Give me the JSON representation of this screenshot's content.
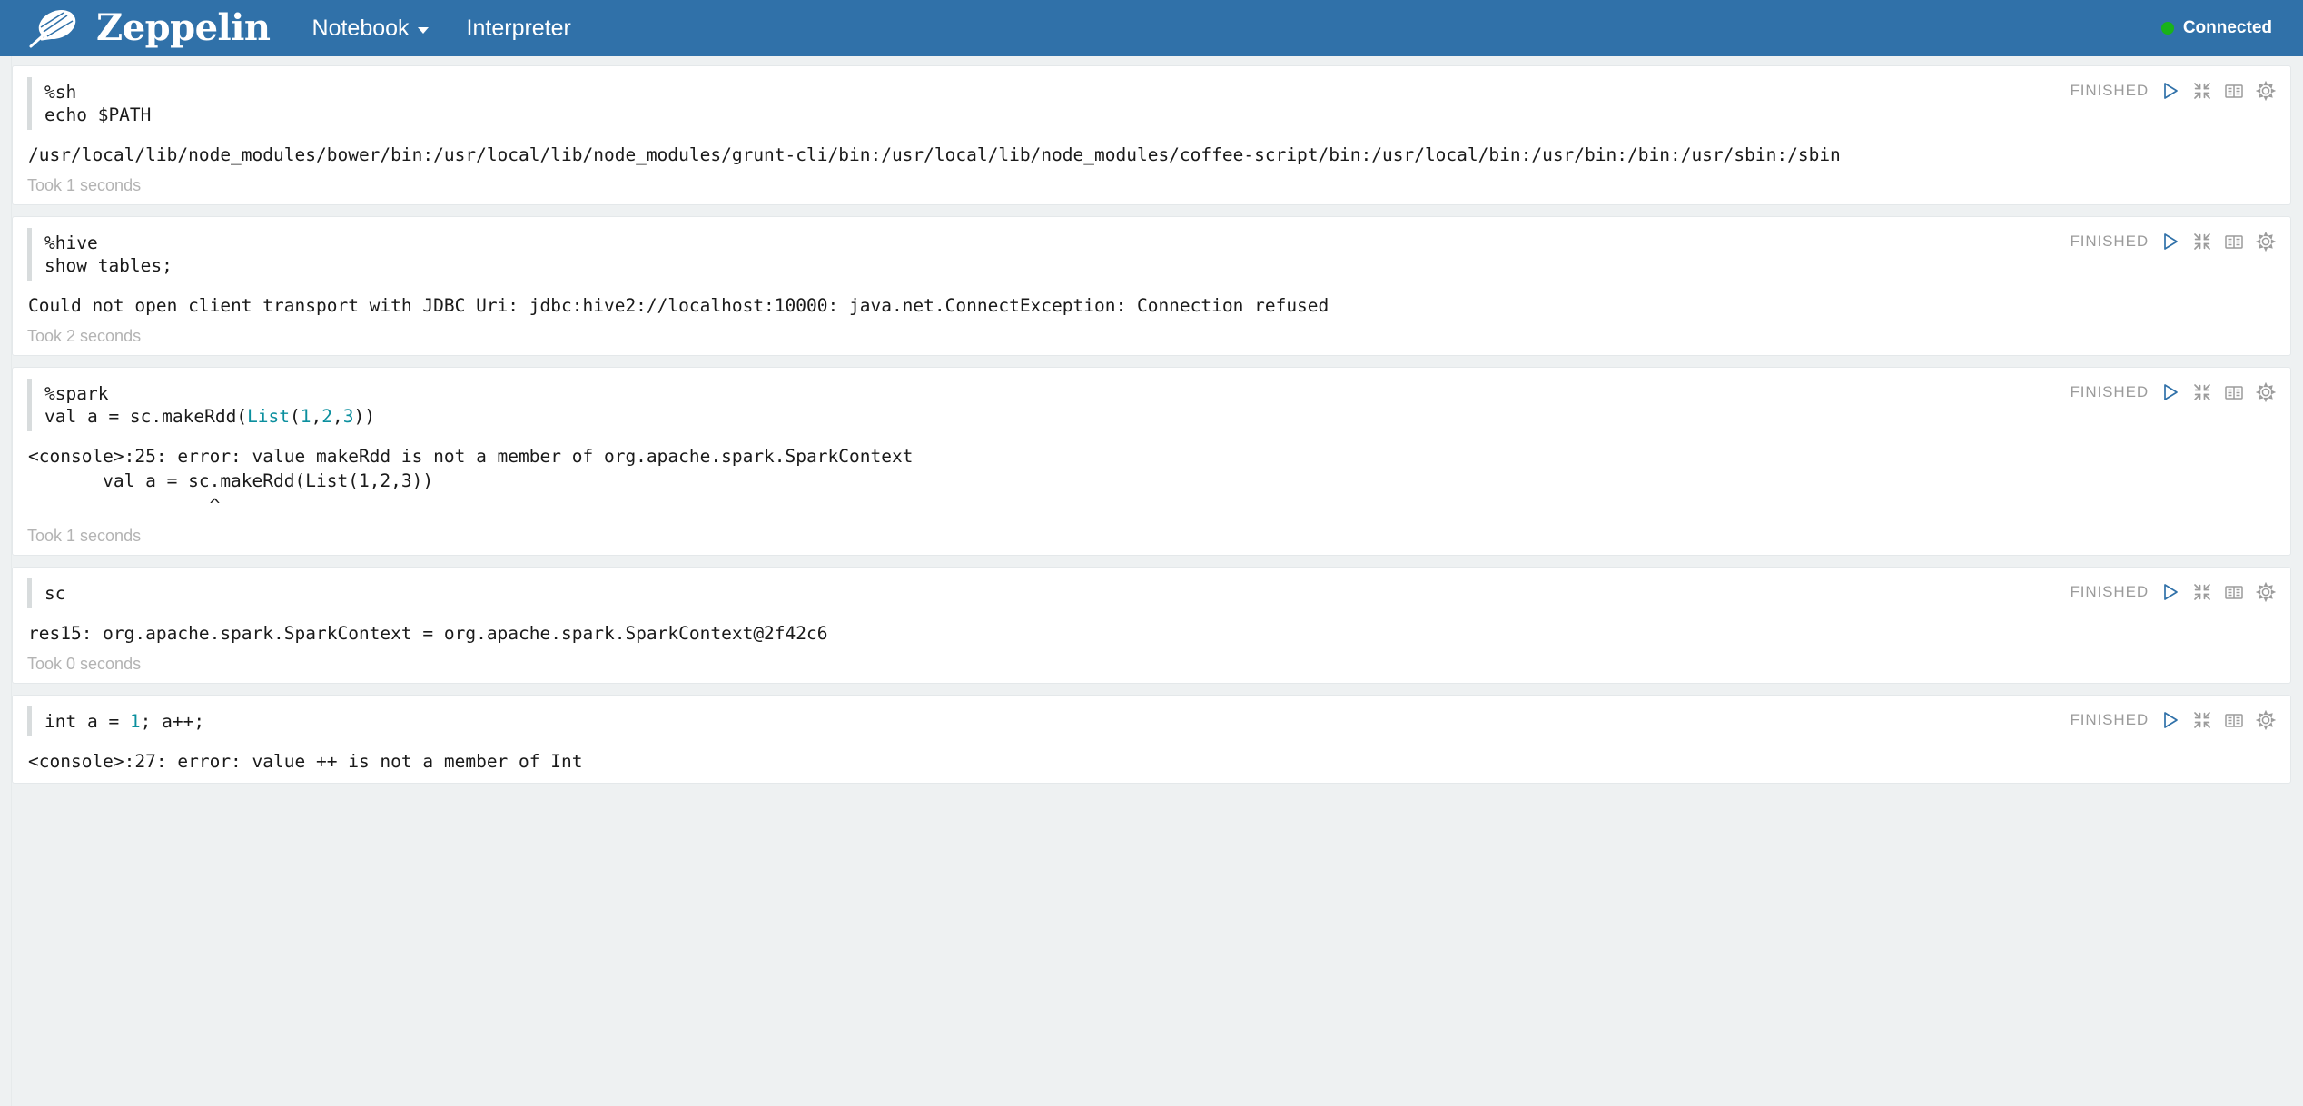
{
  "header": {
    "brand_name": "Zeppelin",
    "logo_icon": "zeppelin-leaf-logo",
    "nav": [
      {
        "label": "Notebook",
        "has_caret": true
      },
      {
        "label": "Interpreter",
        "has_caret": false
      }
    ],
    "connection": {
      "label": "Connected",
      "dot_icon": "status-dot-icon",
      "color": "#19b319"
    }
  },
  "colors": {
    "navbar": "#3071a9",
    "page_background": "#eef1f2",
    "cell_background": "#ffffff",
    "syntax_keyword": "#0b8f9e",
    "run_icon": "#3071a9",
    "status_text": "#9b9b9b"
  },
  "paragraph_controls": {
    "status": "FINISHED",
    "icons": [
      {
        "name": "run-icon",
        "title": "Run"
      },
      {
        "name": "collapse-icon",
        "title": "Collapse"
      },
      {
        "name": "book-icon",
        "title": "Show/Hide editor"
      },
      {
        "name": "gear-icon",
        "title": "Settings"
      }
    ]
  },
  "paragraphs": [
    {
      "id": "paragraph-sh",
      "code": [
        {
          "segments": [
            {
              "text": "%sh",
              "style": "plain"
            }
          ]
        },
        {
          "segments": [
            {
              "text": "echo $PATH",
              "style": "plain"
            }
          ]
        }
      ],
      "status": "FINISHED",
      "result": "/usr/local/lib/node_modules/bower/bin:/usr/local/lib/node_modules/grunt-cli/bin:/usr/local/lib/node_modules/coffee-script/bin:/usr/local/bin:/usr/bin:/bin:/usr/sbin:/sbin",
      "took": "Took 1 seconds"
    },
    {
      "id": "paragraph-hive",
      "code": [
        {
          "segments": [
            {
              "text": "%hive",
              "style": "plain"
            }
          ]
        },
        {
          "segments": [
            {
              "text": "show tables;",
              "style": "plain"
            }
          ]
        }
      ],
      "status": "FINISHED",
      "result": "Could not open client transport with JDBC Uri: jdbc:hive2://localhost:10000: java.net.ConnectException: Connection refused",
      "took": "Took 2 seconds"
    },
    {
      "id": "paragraph-spark",
      "code": [
        {
          "segments": [
            {
              "text": "%spark",
              "style": "plain"
            }
          ]
        },
        {
          "segments": [
            {
              "text": "val a = sc.makeRdd(",
              "style": "plain"
            },
            {
              "text": "List",
              "style": "type"
            },
            {
              "text": "(",
              "style": "plain"
            },
            {
              "text": "1",
              "style": "num"
            },
            {
              "text": ",",
              "style": "plain"
            },
            {
              "text": "2",
              "style": "num"
            },
            {
              "text": ",",
              "style": "plain"
            },
            {
              "text": "3",
              "style": "num"
            },
            {
              "text": "))",
              "style": "plain"
            }
          ]
        }
      ],
      "status": "FINISHED",
      "result": "<console>:25: error: value makeRdd is not a member of org.apache.spark.SparkContext\n       val a = sc.makeRdd(List(1,2,3))\n                 ^",
      "took": "Took 1 seconds"
    },
    {
      "id": "paragraph-sc",
      "code": [
        {
          "segments": [
            {
              "text": "sc",
              "style": "plain"
            }
          ]
        }
      ],
      "status": "FINISHED",
      "result": "res15: org.apache.spark.SparkContext = org.apache.spark.SparkContext@2f42c6",
      "took": "Took 0 seconds"
    },
    {
      "id": "paragraph-int",
      "code": [
        {
          "segments": [
            {
              "text": "int a = ",
              "style": "plain"
            },
            {
              "text": "1",
              "style": "num"
            },
            {
              "text": "; a++;",
              "style": "plain"
            }
          ]
        }
      ],
      "status": "FINISHED",
      "result": "<console>:27: error: value ++ is not a member of Int",
      "took": ""
    }
  ]
}
